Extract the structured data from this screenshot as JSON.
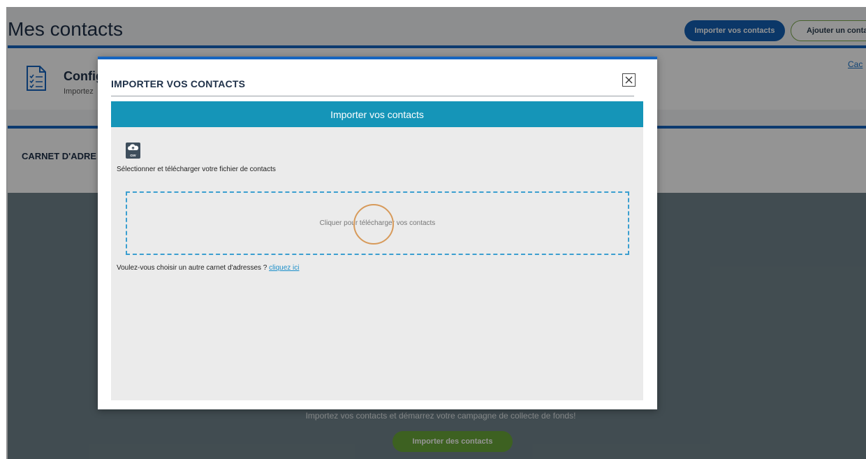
{
  "page": {
    "title": "Mes contacts",
    "import_button": "Importer vos contacts",
    "add_button": "Ajouter un conta",
    "config": {
      "title": "Config",
      "subtitle": "Importez",
      "link": "Cac"
    },
    "address_book": {
      "title": "CARNET D'ADRE"
    },
    "empty": {
      "text": "Importez vos contacts et démarrez votre campagne de collecte de fonds!",
      "button": "Importer des contacts"
    }
  },
  "modal": {
    "title": "IMPORTER VOS CONTACTS",
    "header": "Importer vos contacts",
    "csv_icon_label": "csv",
    "select_text": "Sélectionner et télécharger votre fichier de contacts",
    "dropzone_text": "Cliquer pour télécharger vos contacts",
    "other_text": "Voulez-vous choisir un autre carnet d'adresses ? ",
    "other_link": "cliquez ici"
  },
  "colors": {
    "primary_blue": "#1360b3",
    "accent_teal": "#1595b8",
    "accent_green": "#6aa83a",
    "dropzone_border": "#3b9fd0",
    "click_ring": "#d79a5a"
  },
  "icons": {
    "config": "checklist-document-icon",
    "csv": "csv-cloud-upload-icon",
    "close": "close-icon"
  }
}
